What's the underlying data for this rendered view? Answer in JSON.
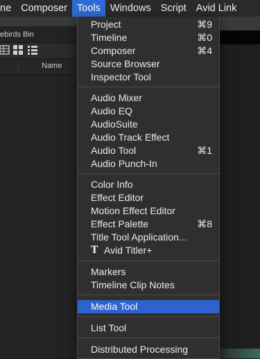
{
  "menubar": {
    "items": [
      "ne",
      "Composer",
      "Tools",
      "Windows",
      "Script",
      "Avid Link"
    ],
    "active": "Tools"
  },
  "bin": {
    "title": "ebirds Bin",
    "column_name": "Name",
    "view_icons": [
      "frame-view-icon",
      "script-view-icon",
      "list-view-icon"
    ]
  },
  "tools_menu": {
    "groups": [
      [
        {
          "label": "Project",
          "shortcut": "⌘9"
        },
        {
          "label": "Timeline",
          "shortcut": "⌘0"
        },
        {
          "label": "Composer",
          "shortcut": "⌘4"
        },
        {
          "label": "Source Browser",
          "shortcut": ""
        },
        {
          "label": "Inspector Tool",
          "shortcut": ""
        }
      ],
      [
        {
          "label": "Audio Mixer",
          "shortcut": ""
        },
        {
          "label": "Audio EQ",
          "shortcut": ""
        },
        {
          "label": "AudioSuite",
          "shortcut": ""
        },
        {
          "label": "Audio Track Effect",
          "shortcut": ""
        },
        {
          "label": "Audio Tool",
          "shortcut": "⌘1"
        },
        {
          "label": "Audio Punch-In",
          "shortcut": ""
        }
      ],
      [
        {
          "label": "Color Info",
          "shortcut": ""
        },
        {
          "label": "Effect Editor",
          "shortcut": ""
        },
        {
          "label": "Motion Effect Editor",
          "shortcut": ""
        },
        {
          "label": "Effect Palette",
          "shortcut": "⌘8"
        },
        {
          "label": "Title Tool Application...",
          "shortcut": ""
        },
        {
          "label": "Avid Titler+",
          "shortcut": "",
          "icon": "titler-t-icon",
          "icon_glyph": "T"
        }
      ],
      [
        {
          "label": "Markers",
          "shortcut": ""
        },
        {
          "label": "Timeline Clip Notes",
          "shortcut": ""
        }
      ],
      [
        {
          "label": "Media Tool",
          "shortcut": "",
          "highlighted": true
        }
      ],
      [
        {
          "label": "List Tool",
          "shortcut": ""
        }
      ],
      [
        {
          "label": "Distributed Processing",
          "shortcut": ""
        }
      ]
    ]
  },
  "colors": {
    "menu_highlight": "#2e62cc",
    "menubar_active": "#2e6bd6"
  }
}
